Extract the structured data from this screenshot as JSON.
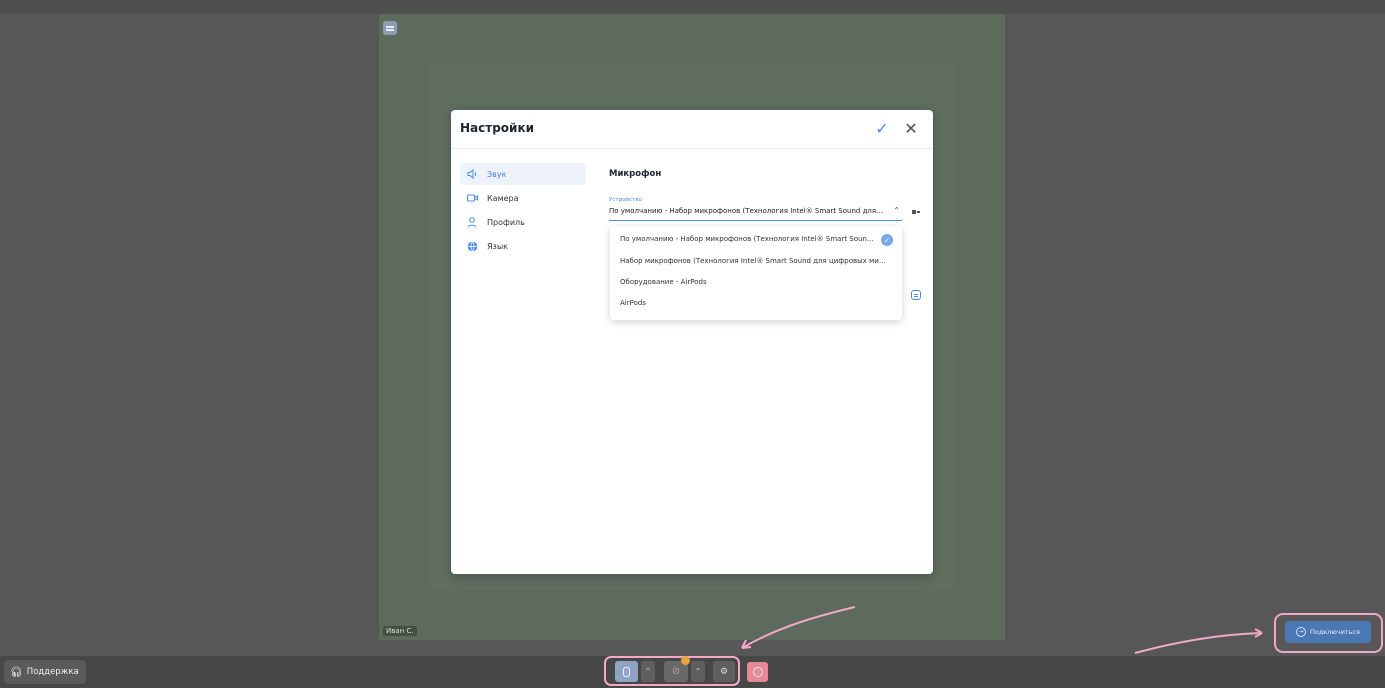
{
  "modal": {
    "title": "Настройки"
  },
  "nav": [
    {
      "label": "Звук",
      "icon": "speaker-icon"
    },
    {
      "label": "Камера",
      "icon": "camera-icon"
    },
    {
      "label": "Профиль",
      "icon": "user-icon"
    },
    {
      "label": "Язык",
      "icon": "globe-icon"
    }
  ],
  "microphone": {
    "section_title": "Микрофон",
    "device_label": "Устройство",
    "selected_device": "По умолчанию - Набор микрофонов (Технология Intel® Smart Sound для цифровых микрофонов)",
    "options": [
      "По умолчанию - Набор микрофонов (Технология Intel® Smart Sound для цифровых микрофонов)",
      "Набор микрофонов (Технология Intel® Smart Sound для цифровых микрофонов)",
      "Оборудование - AirPods",
      "AirPods"
    ]
  },
  "video_tile": {
    "name": "Иван С."
  },
  "bottom_bar": {
    "support_label": "Поддержка",
    "connect_label": "Подключиться"
  },
  "colors": {
    "accent": "#4a8ce8",
    "highlight": "#f1a9c8",
    "background": "#575757",
    "leave": "#e88a95",
    "connect": "#4b77b4"
  }
}
